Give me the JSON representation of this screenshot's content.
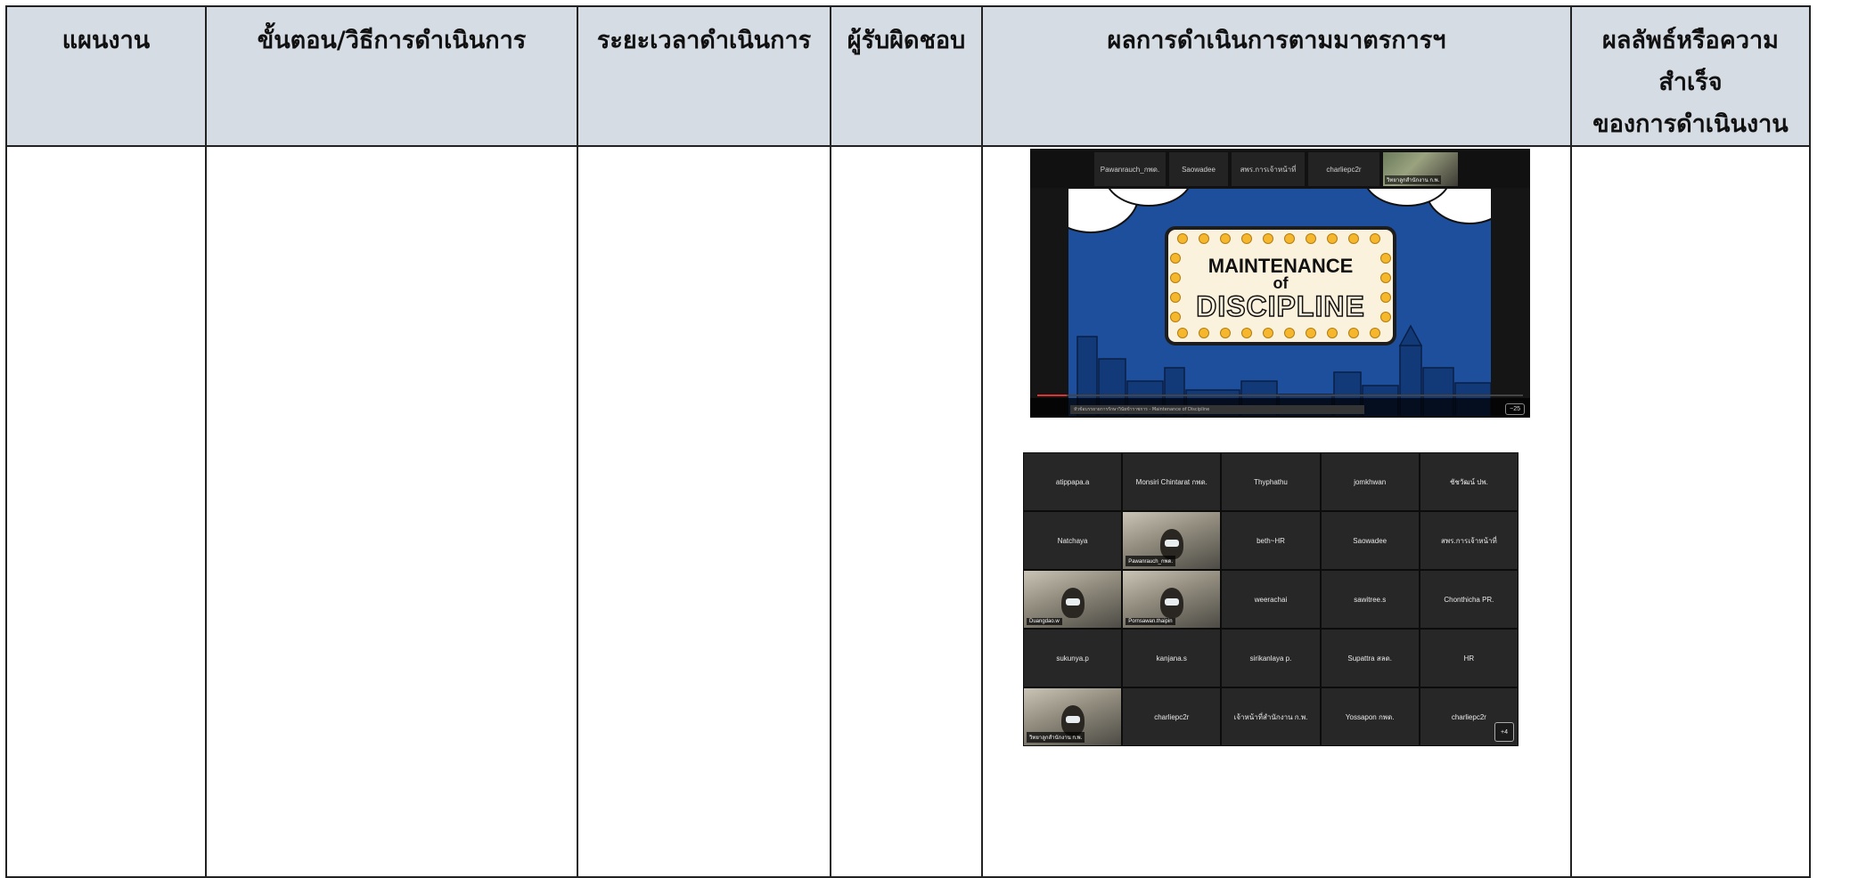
{
  "table": {
    "headers": {
      "plan": "แผนงาน",
      "procedure": "ขั้นตอน/วิธีการดำเนินการ",
      "duration": "ระยะเวลาดำเนินการ",
      "responsible": "ผู้รับผิดชอบ",
      "results": "ผลการดำเนินการตามมาตรการฯ",
      "outcome_line1": "ผลลัพธ์หรือความสำเร็จ",
      "outcome_line2": "ของการดำเนินงาน"
    }
  },
  "screenshot_video": {
    "top_names": [
      "Pawanrauch_กพด.",
      "Saowadee",
      "สพร.การเจ้าหน้าที่",
      "charliepc2r"
    ],
    "camera_label": "วิทยาลูกสำนักงาน ก.พ.",
    "slide": {
      "line1": "MAINTENANCE",
      "line2": "of",
      "line3": "DISCIPLINE"
    },
    "time_badge": "−25",
    "progress": 0.06,
    "caption": "หัวข้อบรรยายการรักษาวินัยข้าราชการ - Maintenance of Discipline"
  },
  "screenshot_grid": {
    "tiles": [
      {
        "name": "atippapa.a",
        "video": false
      },
      {
        "name": "Monsiri Chintarat กพด.",
        "video": false
      },
      {
        "name": "Thyphathu",
        "video": false
      },
      {
        "name": "jomkhwan",
        "video": false
      },
      {
        "name": "ชัชวัฒน์ ปพ.",
        "video": false
      },
      {
        "name": "Natchaya",
        "video": false
      },
      {
        "name": "Pawanrauch_กพด.",
        "video": true
      },
      {
        "name": "beth~HR",
        "video": false
      },
      {
        "name": "Saowadee",
        "video": false
      },
      {
        "name": "สพร.การเจ้าหน้าที่",
        "video": false
      },
      {
        "name": "Duangdao.w",
        "video": true
      },
      {
        "name": "Pornsawan.thaipin",
        "video": true
      },
      {
        "name": "weerachai",
        "video": false
      },
      {
        "name": "sawitree.s",
        "video": false
      },
      {
        "name": "Chonthicha PR.",
        "video": false
      },
      {
        "name": "sukunya.p",
        "video": false
      },
      {
        "name": "kanjana.s",
        "video": false
      },
      {
        "name": "sirikanlaya p.",
        "video": false
      },
      {
        "name": "Supattra สลด.",
        "video": false
      },
      {
        "name": "HR",
        "video": false
      },
      {
        "name": "วิทยาลูกสำนักงาน ก.พ.",
        "video": true
      },
      {
        "name": "charliepc2r",
        "video": false
      },
      {
        "name": "เจ้าหน้าที่สำนักงาน ก.พ.",
        "video": false
      },
      {
        "name": "Yossapon กพด.",
        "video": false
      },
      {
        "name": "charliepc2r",
        "video": false
      }
    ],
    "overflow_count": "+4"
  }
}
